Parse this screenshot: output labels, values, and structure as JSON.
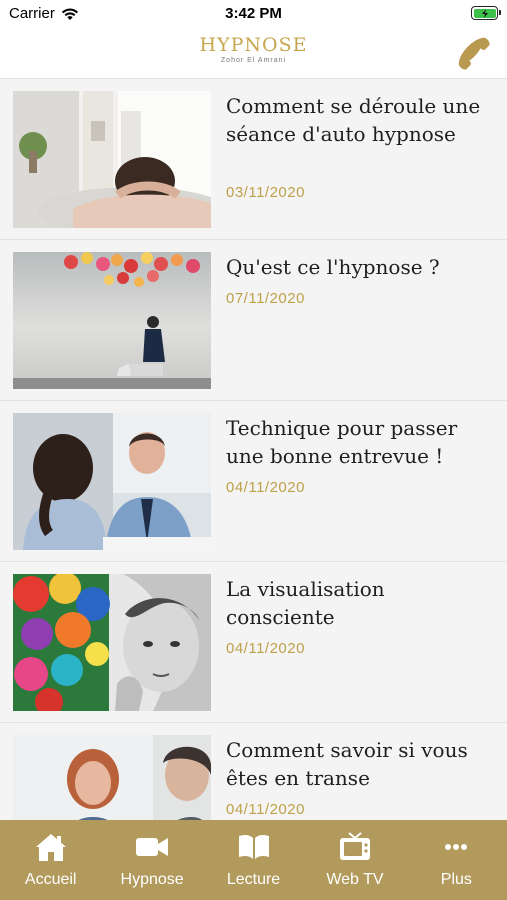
{
  "status": {
    "carrier": "Carrier",
    "time": "3:42 PM"
  },
  "header": {
    "title": "HYPNOSE",
    "subtitle": "Zohor El Amrani"
  },
  "articles": [
    {
      "title": "Comment se déroule une séance d'auto hypnose",
      "date": "03/11/2020"
    },
    {
      "title": "Qu'est ce l'hypnose ?",
      "date": "07/11/2020"
    },
    {
      "title": "Technique pour passer une bonne entrevue !",
      "date": "04/11/2020"
    },
    {
      "title": "La visualisation consciente",
      "date": "04/11/2020"
    },
    {
      "title": "Comment savoir si vous êtes en transe",
      "date": "04/11/2020"
    }
  ],
  "tabs": [
    {
      "label": "Accueil",
      "icon": "home-icon"
    },
    {
      "label": "Hypnose",
      "icon": "video-camera-icon"
    },
    {
      "label": "Lecture",
      "icon": "book-icon"
    },
    {
      "label": "Web TV",
      "icon": "tv-icon"
    },
    {
      "label": "Plus",
      "icon": "more-icon"
    }
  ],
  "colors": {
    "accent": "#b29a5c",
    "date": "#bfa14a",
    "logo": "#c7a74d",
    "battery": "#3bc14a"
  }
}
